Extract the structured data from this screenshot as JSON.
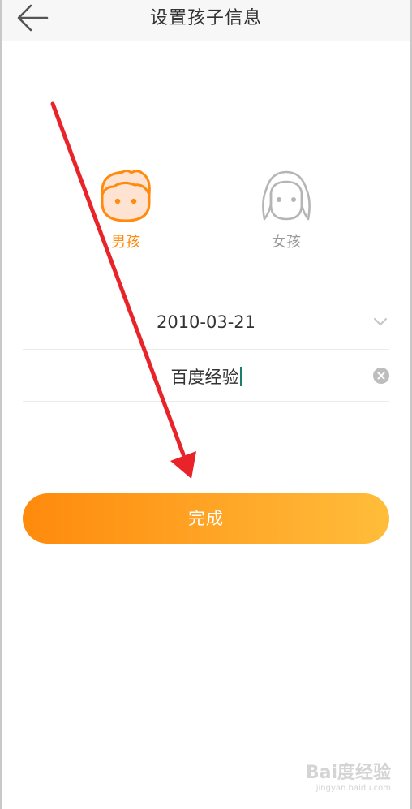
{
  "header": {
    "title": "设置孩子信息",
    "back_icon": "arrow-left-icon"
  },
  "gender": {
    "boy_label": "男孩",
    "girl_label": "女孩",
    "selected": "boy",
    "accent_color": "#ff8a0c",
    "inactive_color": "#9a9a9a"
  },
  "birthday": {
    "value": "2010-03-21",
    "icon": "chevron-down-icon"
  },
  "name": {
    "value": "百度经验",
    "clear_icon": "clear-circle-icon"
  },
  "done_button": {
    "label": "完成",
    "gradient_start": "#ff8a0c",
    "gradient_end": "#ffbd3a"
  },
  "annotation": {
    "arrow_color": "#e8232a"
  },
  "watermark": {
    "logo_text": "Bai度经验",
    "sub_text": "jingyan.baidu.com"
  }
}
